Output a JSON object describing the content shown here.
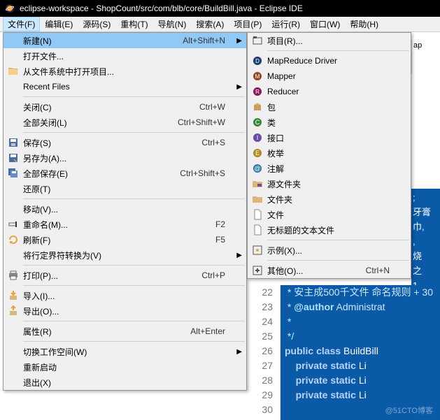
{
  "titlebar": {
    "text": "eclipse-workspace - ShopCount/src/com/blb/core/BuildBill.java - Eclipse IDE"
  },
  "menubar": {
    "items": [
      {
        "label": "文件(F)",
        "active": true
      },
      {
        "label": "编辑(E)"
      },
      {
        "label": "源码(S)"
      },
      {
        "label": "重构(T)"
      },
      {
        "label": "导航(N)"
      },
      {
        "label": "搜索(A)"
      },
      {
        "label": "项目(P)"
      },
      {
        "label": "运行(R)"
      },
      {
        "label": "窗口(W)"
      },
      {
        "label": "帮助(H)"
      }
    ]
  },
  "menu1": {
    "items": [
      {
        "icon": null,
        "label": "新建(N)",
        "shortcut": "Alt+Shift+N",
        "arrow": true,
        "hl": true
      },
      {
        "icon": null,
        "label": "打开文件..."
      },
      {
        "icon": "open-folder",
        "label": "从文件系统中打开项目..."
      },
      {
        "icon": null,
        "label": "Recent Files",
        "arrow": true
      },
      {
        "sep": true
      },
      {
        "icon": null,
        "label": "关闭(C)",
        "shortcut": "Ctrl+W"
      },
      {
        "icon": null,
        "label": "全部关闭(L)",
        "shortcut": "Ctrl+Shift+W"
      },
      {
        "sep": true
      },
      {
        "icon": "save",
        "label": "保存(S)",
        "shortcut": "Ctrl+S"
      },
      {
        "icon": "save-as",
        "label": "另存为(A)..."
      },
      {
        "icon": "save-all",
        "label": "全部保存(E)",
        "shortcut": "Ctrl+Shift+S"
      },
      {
        "icon": null,
        "label": "还原(T)"
      },
      {
        "sep": true
      },
      {
        "icon": null,
        "label": "移动(V)..."
      },
      {
        "icon": "rename",
        "label": "重命名(M)...",
        "shortcut": "F2"
      },
      {
        "icon": "refresh",
        "label": "刷新(F)",
        "shortcut": "F5"
      },
      {
        "icon": null,
        "label": "将行定界符转换为(V)",
        "arrow": true
      },
      {
        "sep": true
      },
      {
        "icon": "print",
        "label": "打印(P)...",
        "shortcut": "Ctrl+P"
      },
      {
        "sep": true
      },
      {
        "icon": "import",
        "label": "导入(I)..."
      },
      {
        "icon": "export",
        "label": "导出(O)..."
      },
      {
        "sep": true
      },
      {
        "icon": null,
        "label": "属性(R)",
        "shortcut": "Alt+Enter"
      },
      {
        "sep": true
      },
      {
        "icon": null,
        "label": "切换工作空间(W)",
        "arrow": true
      },
      {
        "icon": null,
        "label": "重新启动"
      },
      {
        "icon": null,
        "label": "退出(X)"
      }
    ]
  },
  "menu2": {
    "items": [
      {
        "icon": "project",
        "label": "项目(R)..."
      },
      {
        "sep": true
      },
      {
        "icon": "mapreduce",
        "label": "MapReduce Driver"
      },
      {
        "icon": "mapper",
        "label": "Mapper"
      },
      {
        "icon": "reducer",
        "label": "Reducer"
      },
      {
        "icon": "package",
        "label": "包"
      },
      {
        "icon": "class",
        "label": "类"
      },
      {
        "icon": "interface",
        "label": "接口"
      },
      {
        "icon": "enum",
        "label": "枚举"
      },
      {
        "icon": "annotation",
        "label": "注解"
      },
      {
        "icon": "source-folder",
        "label": "源文件夹"
      },
      {
        "icon": "folder",
        "label": "文件夹"
      },
      {
        "icon": "file",
        "label": "文件"
      },
      {
        "icon": "untitled",
        "label": "无标题的文本文件"
      },
      {
        "sep": true
      },
      {
        "icon": "example",
        "label": "示例(X)..."
      },
      {
        "sep": true
      },
      {
        "icon": "other",
        "label": "其他(O)...",
        "shortcut": "Ctrl+N"
      }
    ]
  },
  "editor_tab_partial": "ap",
  "far_right_lines": [
    ";",
    "牙膏",
    "巾,",
    ",",
    "烧",
    "之",
    "1"
  ],
  "code": {
    "gutter": [
      "22",
      "23",
      "24",
      "25",
      "26",
      "27",
      "28",
      "29",
      "30"
    ],
    "lines": [
      {
        "html": " <span class='jd'>* 安主成500千文件 命名规则 + 30</span>"
      },
      {
        "html": " <span class='jd'>* <span class='jdtag'>@author</span> Administrat</span>"
      },
      {
        "html": " <span class='jd'>*</span>"
      },
      {
        "html": " <span class='jd'>*/</span>"
      },
      {
        "html": "<span class='kw'>public class</span> BuildBill"
      },
      {
        "html": "    <span class='kw'>private static</span> Li"
      },
      {
        "html": "    <span class='kw'>private static</span> Li"
      },
      {
        "html": "    <span class='kw'>private static</span> Li"
      },
      {
        "html": "    "
      }
    ]
  },
  "watermark": "@51CTO博客"
}
